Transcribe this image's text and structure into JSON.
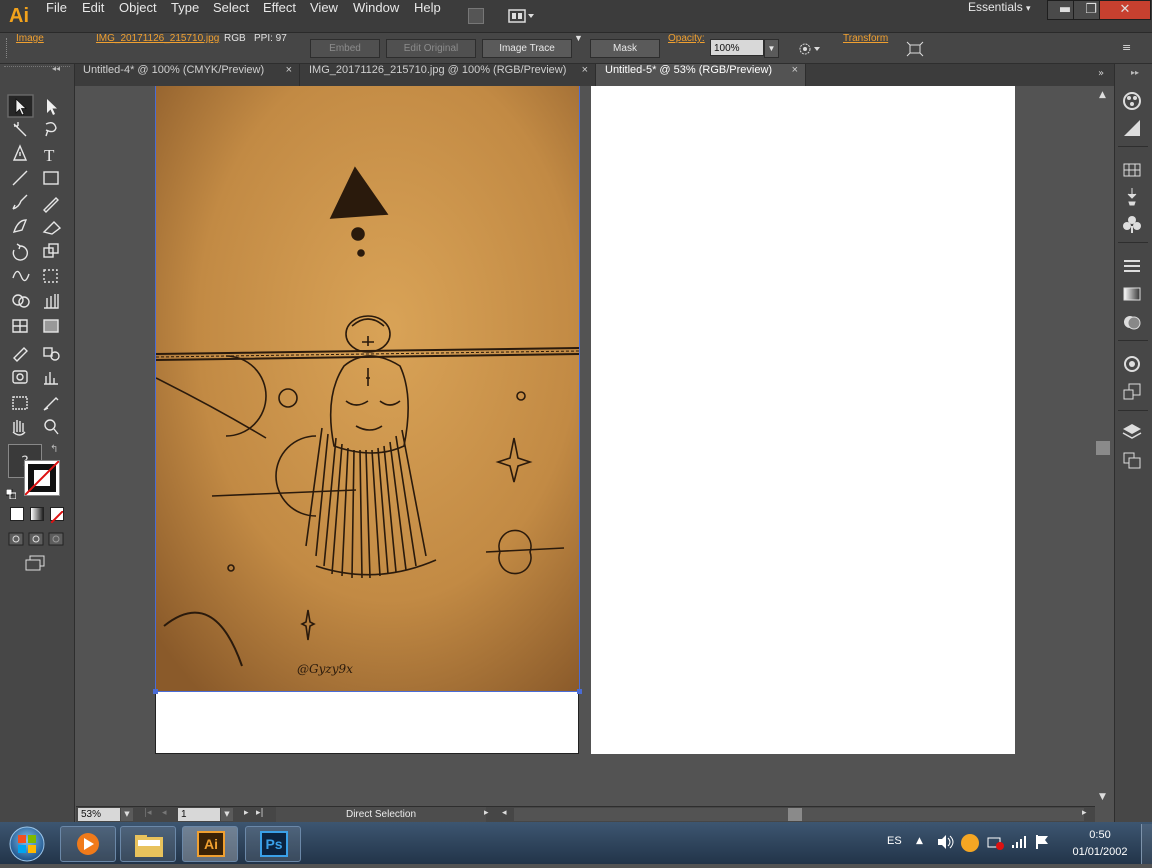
{
  "app": {
    "logo": "Ai",
    "name": "Adobe Illustrator"
  },
  "menu": [
    "File",
    "Edit",
    "Object",
    "Type",
    "Select",
    "Effect",
    "View",
    "Window",
    "Help"
  ],
  "workspace": {
    "label": "Essentials",
    "arrow": "▾"
  },
  "window_controls": {
    "minimize": "▬",
    "restore": "❐",
    "close": "✕"
  },
  "control_bar": {
    "object_type": "Image",
    "file_link": "IMG_20171126_215710.jpg",
    "color_mode": "RGB",
    "ppi": "PPI: 97",
    "embed": "Embed",
    "edit_original": "Edit Original",
    "image_trace": "Image Trace",
    "mask": "Mask",
    "opacity_label": "Opacity:",
    "opacity_value": "100%",
    "transform": "Transform"
  },
  "tabs": [
    {
      "label": "Untitled-4* @ 100% (CMYK/Preview)",
      "close": "×"
    },
    {
      "label": "IMG_20171126_215710.jpg @ 100% (RGB/Preview)",
      "close": "×"
    },
    {
      "label": "Untitled-5* @ 53% (RGB/Preview)",
      "close": "×",
      "active": true
    }
  ],
  "artwork": {
    "signature": "@Gyzy9x"
  },
  "status_bar": {
    "zoom": "53%",
    "page": "1",
    "tool": "Direct Selection"
  },
  "toolbar": {
    "question": "?"
  },
  "taskbar": {
    "apps": [
      "media-player",
      "file-explorer",
      "illustrator",
      "photoshop"
    ],
    "ai_label": "Ai",
    "ps_label": "Ps",
    "language": "ES",
    "time": "0:50",
    "date": "01/01/2002"
  },
  "colors": {
    "ui_dark": "#3c3c3c",
    "ui_mid": "#474747",
    "canvas": "#535353",
    "accent_orange": "#f0a030",
    "selection_blue": "#4a6cd6",
    "paper": "#c08a42"
  }
}
